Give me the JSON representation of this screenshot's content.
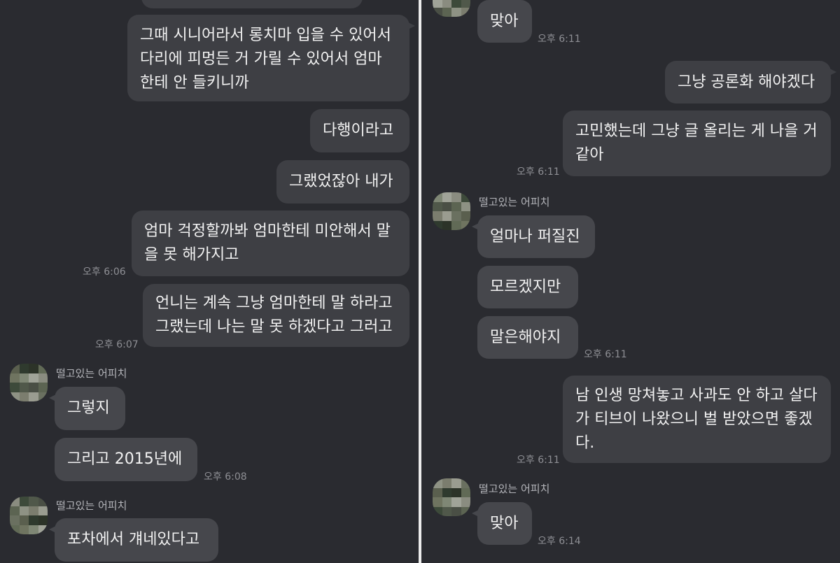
{
  "left": {
    "messages": [
      {
        "id": "l0",
        "side": "mine",
        "text": ""
      },
      {
        "id": "l1",
        "side": "mine",
        "text": "그때 시니어라서 롱치마 입을 수 있어서\n다리에 피멍든 거 가릴 수 있어서 엄마\n한테 안 들키니까"
      },
      {
        "id": "l2",
        "side": "mine",
        "text": "다행이라고"
      },
      {
        "id": "l3",
        "side": "mine",
        "text": "그랬었잖아 내가"
      },
      {
        "id": "l4",
        "side": "mine",
        "text": "엄마 걱정할까봐 엄마한테 미안해서 말\n을 못 해가지고",
        "time": "오후 6:06"
      },
      {
        "id": "l5",
        "side": "mine",
        "text": "언니는 계속 그냥 엄마한테 말 하라고\n그랬는데 나는 말 못 하겠다고 그러고",
        "time": "오후 6:07"
      },
      {
        "id": "l6",
        "side": "theirs",
        "sender": "떨고있는 어피치",
        "text": "그렇지"
      },
      {
        "id": "l7",
        "side": "theirs",
        "text": "그리고 2015년에",
        "time": "오후 6:08"
      },
      {
        "id": "l8",
        "side": "theirs",
        "sender": "떨고있는 어피치",
        "text": "포차에서 걔네있다고"
      }
    ]
  },
  "right": {
    "messages": [
      {
        "id": "r0",
        "side": "theirs",
        "text": "맞아",
        "time": "오후 6:11"
      },
      {
        "id": "r1",
        "side": "mine",
        "text": "그냥 공론화 해야겠다"
      },
      {
        "id": "r2",
        "side": "mine",
        "text": "고민했는데 그냥 글 올리는 게 나을 거\n같아",
        "time": "오후 6:11"
      },
      {
        "id": "r3",
        "side": "theirs",
        "sender": "떨고있는 어피치",
        "text": "얼마나 퍼질진"
      },
      {
        "id": "r4",
        "side": "theirs",
        "text": "모르겠지만"
      },
      {
        "id": "r5",
        "side": "theirs",
        "text": "말은해야지",
        "time": "오후 6:11"
      },
      {
        "id": "r6",
        "side": "mine",
        "text": "남 인생 망쳐놓고 사과도 안 하고 살다\n가 티브이 나왔으니 벌 받았으면 좋겠\n다.",
        "time": "오후 6:11"
      },
      {
        "id": "r7",
        "side": "theirs",
        "sender": "떨고있는 어피치",
        "text": "맞아",
        "time": "오후 6:14"
      }
    ]
  },
  "avatar": {
    "alt_name": "떨고있는 어피치",
    "pixel_colors": [
      "#5a5f4e",
      "#7b7d6e",
      "#4a4f45",
      "#8a8c80",
      "#6f7460",
      "#2f3a2e",
      "#9a9c90",
      "#5c6452",
      "#3d4a3a",
      "#7f8775",
      "#2c3328",
      "#6a7060",
      "#8e9284",
      "#50584a",
      "#a0a398",
      "#616a56"
    ]
  }
}
